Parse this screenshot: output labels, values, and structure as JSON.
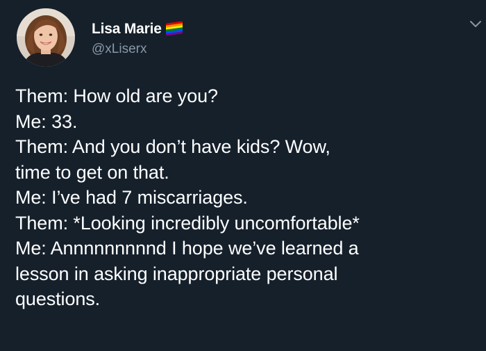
{
  "author": {
    "display_name": "Lisa Marie",
    "handle": "@xLiserx",
    "badge_icon": "rainbow-flag-icon",
    "flag_colors": [
      "#e40303",
      "#ff8c00",
      "#ffed00",
      "#008026",
      "#004dff",
      "#750787"
    ]
  },
  "tweet": {
    "lines": [
      "Them: How old are you?",
      "Me: 33.",
      "Them: And you don’t have kids? Wow,",
      "time to get on that.",
      "Me: I’ve had 7 miscarriages.",
      "Them: *Looking incredibly uncomfortable*",
      "Me: Annnnnnnnnd I hope we’ve learned a",
      "lesson in asking inappropriate personal",
      "questions."
    ]
  },
  "theme": {
    "background": "#15202b",
    "text_primary": "#ffffff",
    "text_secondary": "#8899a6"
  },
  "icons": {
    "menu": "chevron-down-icon",
    "avatar": "avatar-photo"
  }
}
